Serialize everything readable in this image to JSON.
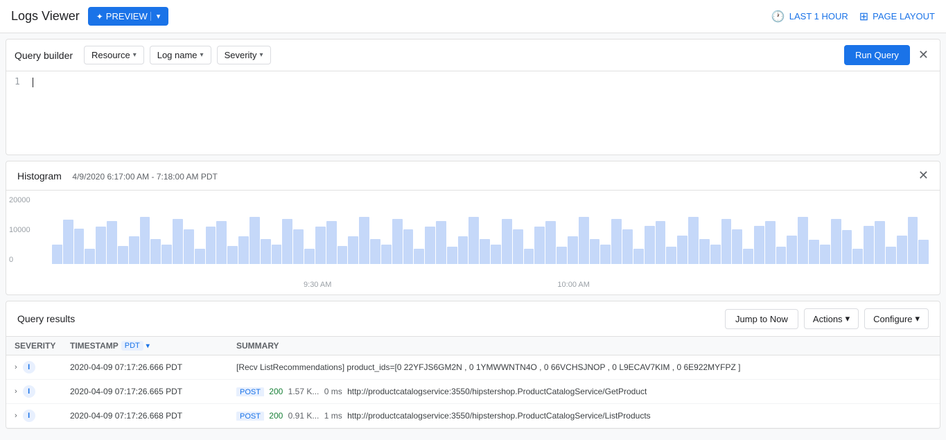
{
  "app": {
    "title": "Logs Viewer",
    "preview_label": "PREVIEW",
    "last_hour_label": "LAST 1 HOUR",
    "page_layout_label": "PAGE LAYOUT"
  },
  "query_builder": {
    "label": "Query builder",
    "resource_label": "Resource",
    "log_name_label": "Log name",
    "severity_label": "Severity",
    "run_query_label": "Run Query",
    "line_number": "1"
  },
  "histogram": {
    "title": "Histogram",
    "range": "4/9/2020 6:17:00 AM - 7:18:00 AM PDT",
    "y_axis": [
      "20000",
      "10000",
      "0"
    ],
    "x_labels": [
      "9:30 AM",
      "10:00 AM"
    ],
    "bar_count": 80
  },
  "results": {
    "title": "Query results",
    "jump_now_label": "Jump to Now",
    "actions_label": "Actions",
    "configure_label": "Configure",
    "columns": {
      "severity": "SEVERITY",
      "timestamp": "TIMESTAMP",
      "pdt_label": "PDT",
      "summary": "SUMMARY"
    },
    "rows": [
      {
        "severity": "I",
        "timestamp": "2020-04-09 07:17:26.666 PDT",
        "summary": "[Recv ListRecommendations] product_ids=[0 22YFJS6GM2N , 0 1YMWWNTN4O , 0 66VCHSJNOP , 0 L9ECAV7KIM , 0 6E922MYFPZ ]"
      },
      {
        "severity": "I",
        "timestamp": "2020-04-09 07:17:26.665 PDT",
        "method": "POST",
        "status": "200",
        "size": "1.57 K...",
        "ms": "0 ms",
        "url": "http://productcatalogservice:3550/hipstershop.ProductCatalogService/GetProduct"
      },
      {
        "severity": "I",
        "timestamp": "2020-04-09 07:17:26.668 PDT",
        "method": "POST",
        "status": "200",
        "size": "0.91 K...",
        "ms": "1 ms",
        "url": "http://productcatalogservice:3550/hipstershop.ProductCatalogService/ListProducts"
      }
    ]
  }
}
